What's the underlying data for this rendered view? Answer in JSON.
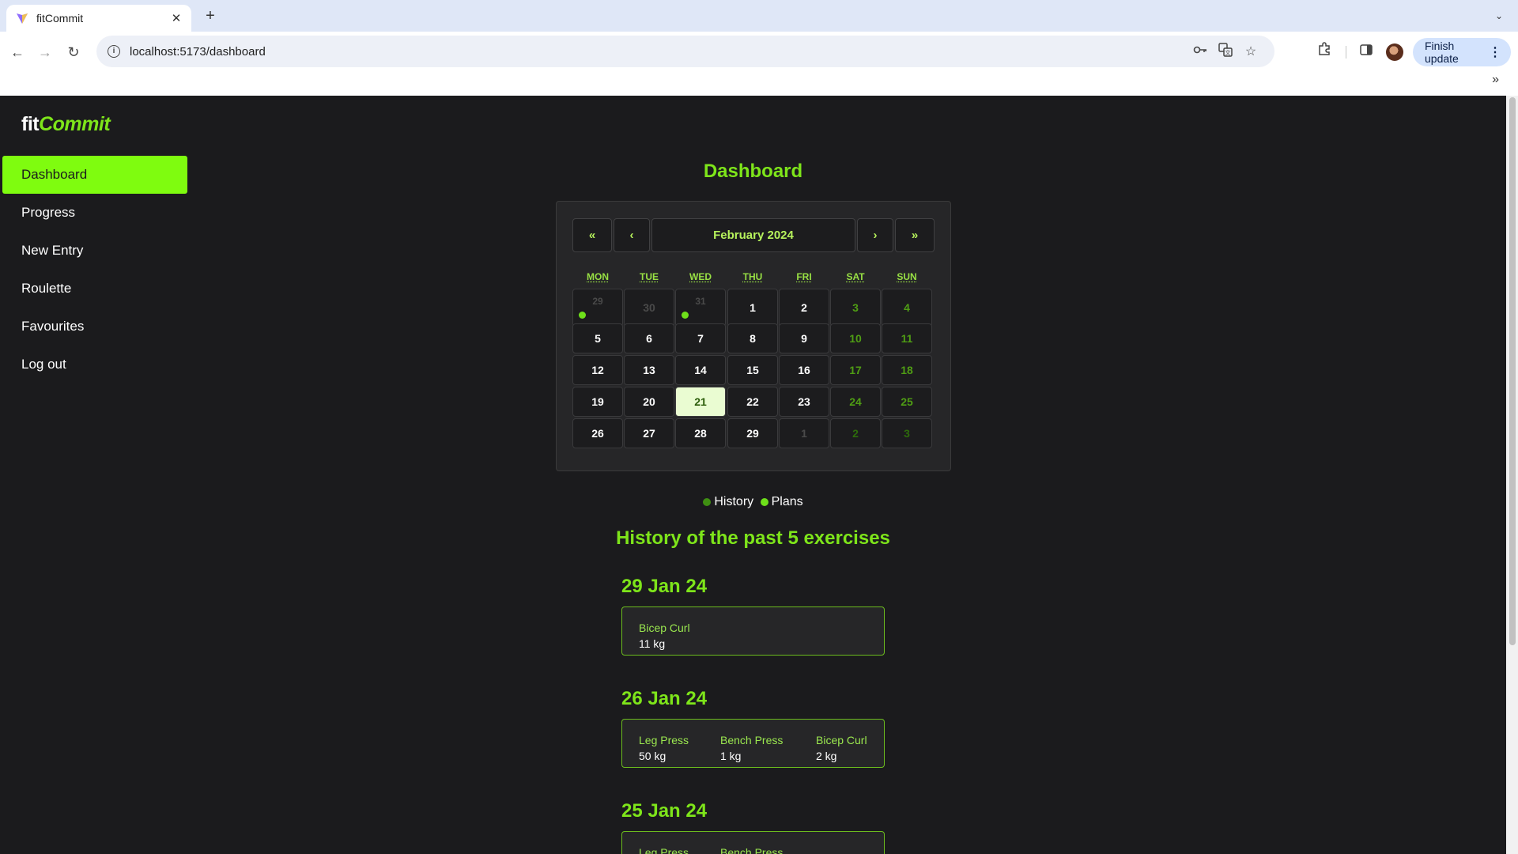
{
  "browser": {
    "tab_title": "fitCommit",
    "tab_close": "✕",
    "new_tab": "+",
    "tab_list": "⌄",
    "url": "localhost:5173/dashboard",
    "back": "←",
    "forward": "→",
    "reload": "↻",
    "finish_update_label": "Finish update",
    "menu_dots": "⋮",
    "bookmarks_chevron": "»"
  },
  "app": {
    "logo_fit": "fit",
    "logo_commit": "Commit",
    "accent_color": "#7ffc0f",
    "nav": [
      {
        "label": "Dashboard",
        "active": true
      },
      {
        "label": "Progress"
      },
      {
        "label": "New Entry"
      },
      {
        "label": "Roulette"
      },
      {
        "label": "Favourites"
      },
      {
        "label": "Log out"
      }
    ],
    "page_title": "Dashboard"
  },
  "calendar": {
    "prev_year": "«",
    "prev_month": "‹",
    "month_label": "February 2024",
    "next_month": "›",
    "next_year": "»",
    "weekdays": [
      "MON",
      "TUE",
      "WED",
      "THU",
      "FRI",
      "SAT",
      "SUN"
    ],
    "weeks": [
      [
        "29",
        "30",
        "31",
        "1",
        "2",
        "3",
        "4"
      ],
      [
        "5",
        "6",
        "7",
        "8",
        "9",
        "10",
        "11"
      ],
      [
        "12",
        "13",
        "14",
        "15",
        "16",
        "17",
        "18"
      ],
      [
        "19",
        "20",
        "21",
        "22",
        "23",
        "24",
        "25"
      ],
      [
        "26",
        "27",
        "28",
        "29",
        "1",
        "2",
        "3"
      ]
    ],
    "selected_day": "21",
    "history_marked_days": [
      "29",
      "31"
    ]
  },
  "legend": {
    "history_label": "History",
    "history_color": "#3f8f12",
    "plans_label": "Plans",
    "plans_color": "#6ee01a"
  },
  "history": {
    "title": "History of the past 5 exercises",
    "entries": [
      {
        "date": "29 Jan 24",
        "exercises": [
          {
            "name": "Bicep Curl",
            "weight": "11 kg"
          }
        ]
      },
      {
        "date": "26 Jan 24",
        "exercises": [
          {
            "name": "Leg Press",
            "weight": "50 kg"
          },
          {
            "name": "Bench Press",
            "weight": "1 kg"
          },
          {
            "name": "Bicep Curl",
            "weight": "2 kg"
          }
        ]
      },
      {
        "date": "25 Jan 24",
        "exercises": [
          {
            "name": "Leg Press",
            "weight": ""
          },
          {
            "name": "Bench Press",
            "weight": ""
          }
        ]
      }
    ]
  }
}
